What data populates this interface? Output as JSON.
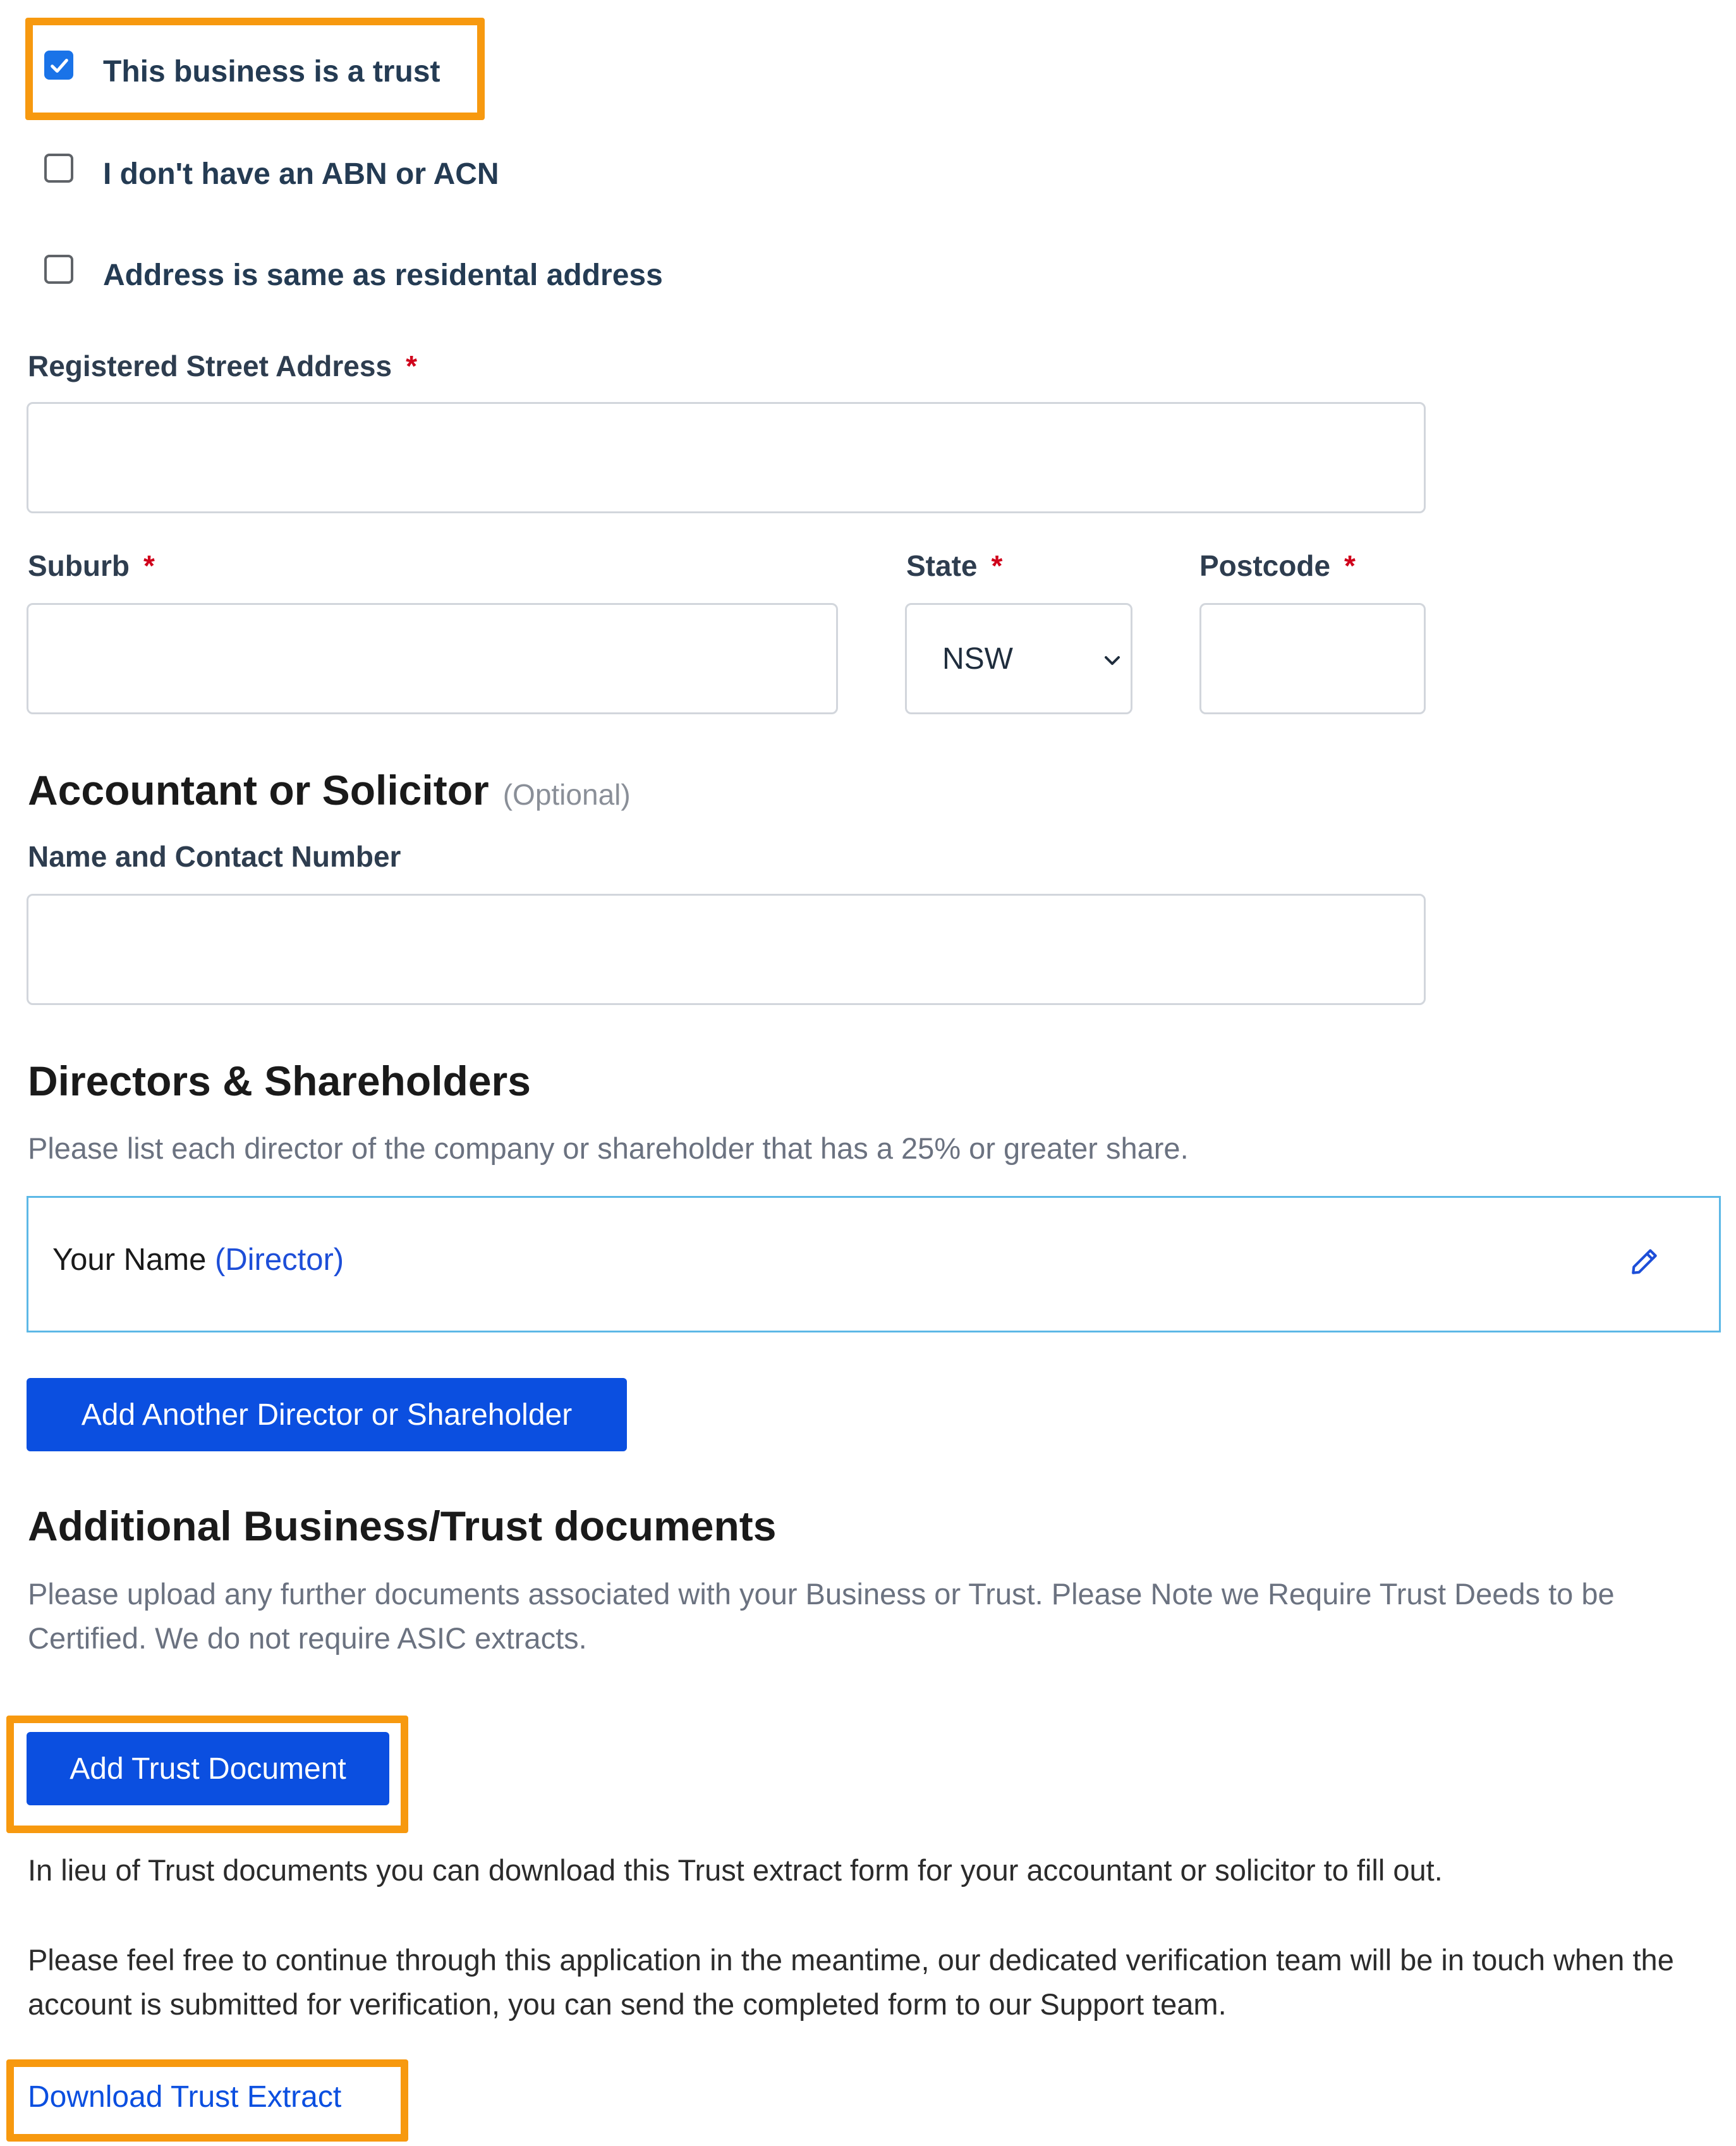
{
  "checkboxes": {
    "trust": {
      "label": "This business is a trust",
      "checked": true
    },
    "no_abn": {
      "label": "I don't have an ABN or ACN",
      "checked": false
    },
    "same_address": {
      "label": "Address is same as residental address",
      "checked": false
    }
  },
  "address": {
    "street_label": "Registered Street Address",
    "suburb_label": "Suburb",
    "state_label": "State",
    "state_value": "NSW",
    "postcode_label": "Postcode",
    "required_mark": "*"
  },
  "accountant": {
    "title": "Accountant or Solicitor",
    "optional": "(Optional)",
    "field_label": "Name and Contact Number"
  },
  "directors": {
    "title": "Directors & Shareholders",
    "description": "Please list each director of the company or shareholder that has a 25% or greater share.",
    "entry_name": "Your Name",
    "entry_role": "(Director)",
    "add_button": "Add Another Director or Shareholder"
  },
  "documents": {
    "title": "Additional Business/Trust documents",
    "description": "Please upload any further documents associated with your Business or Trust. Please Note we Require Trust Deeds to be Certified. We do not require ASIC extracts.",
    "add_button": "Add Trust Document",
    "lieu_text": "In lieu of Trust documents you can download this Trust extract form for your accountant or solicitor to fill out.",
    "continue_text": "Please feel free to continue through this application in the meantime, our dedicated verification team will be in touch when the account is submitted for verification, you can send the completed form to our Support team.",
    "download_link": "Download Trust Extract"
  },
  "colors": {
    "accent": "#0b4fe0",
    "highlight": "#f7990f",
    "required": "#d0021b"
  },
  "icons": {
    "edit": "pencil-icon",
    "select": "chevron-down-icon",
    "check": "check-icon"
  }
}
